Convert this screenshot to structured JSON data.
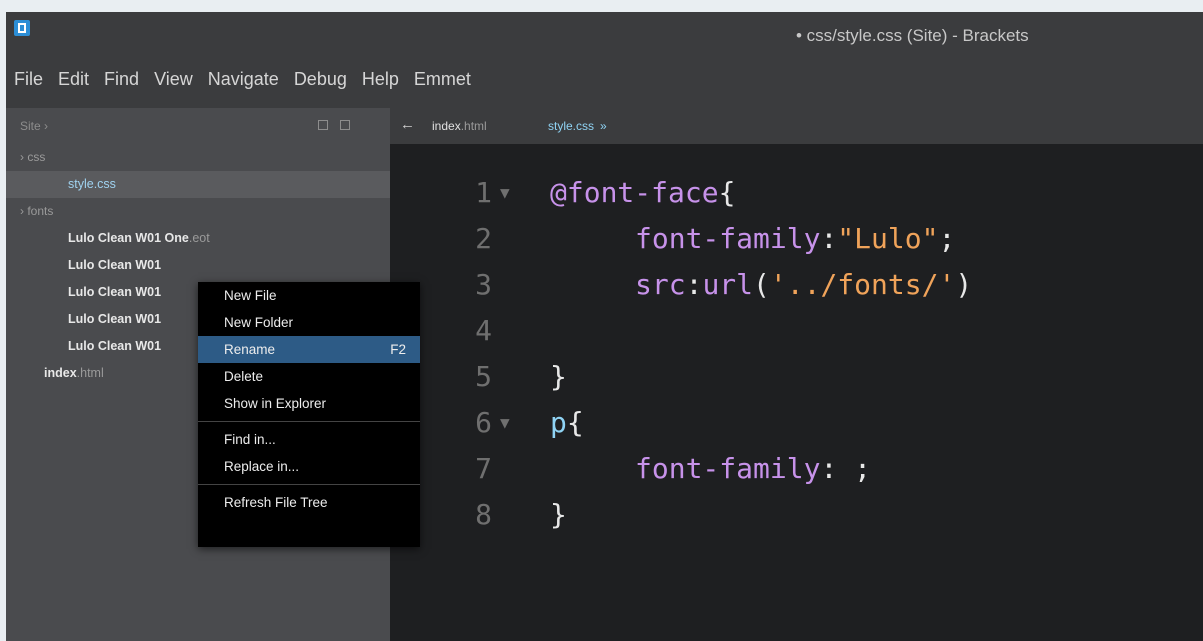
{
  "window": {
    "title": "• css/style.css (Site) - Brackets"
  },
  "menubar": [
    "File",
    "Edit",
    "Find",
    "View",
    "Navigate",
    "Debug",
    "Help",
    "Emmet"
  ],
  "sidebar": {
    "project": "Site ›",
    "tree": [
      {
        "type": "folder",
        "label": "› css"
      },
      {
        "type": "file",
        "label": "style.css",
        "selected": true
      },
      {
        "type": "folder",
        "label": "› fonts"
      },
      {
        "type": "file",
        "name": "Lulo Clean W01 One",
        "ext": ".eot"
      },
      {
        "type": "file",
        "name": "Lulo Clean W01",
        "ext": ""
      },
      {
        "type": "file",
        "name": "Lulo Clean W01",
        "ext": ""
      },
      {
        "type": "file",
        "name": "Lulo Clean W01",
        "ext": ""
      },
      {
        "type": "file",
        "name": "Lulo Clean W01",
        "ext": ""
      },
      {
        "type": "file",
        "name": "index",
        "ext": ".html"
      }
    ]
  },
  "tabs": [
    {
      "name": "index",
      "ext": ".html",
      "active": false
    },
    {
      "name": "style.css",
      "ext": "",
      "active": true,
      "dirty": "»"
    }
  ],
  "context_menu": {
    "items": [
      {
        "label": "New File"
      },
      {
        "label": "New Folder"
      },
      {
        "label": "Rename",
        "shortcut": "F2",
        "highlight": true
      },
      {
        "label": "Delete"
      },
      {
        "label": "Show in Explorer"
      },
      {
        "separator": true
      },
      {
        "label": "Find in..."
      },
      {
        "label": "Replace in..."
      },
      {
        "separator": true
      },
      {
        "label": "Refresh File Tree"
      }
    ]
  },
  "code": {
    "line_numbers": [
      "1",
      "2",
      "3",
      "4",
      "5",
      "6",
      "7",
      "8"
    ],
    "fold_marker": "▼",
    "lines": [
      {
        "tokens": [
          [
            "at",
            "@font-face"
          ],
          [
            "punc",
            "{"
          ]
        ],
        "indent": 0,
        "fold": true
      },
      {
        "tokens": [
          [
            "prop",
            "font-family"
          ],
          [
            "punc",
            ":"
          ],
          [
            "str",
            "\"Lulo\""
          ],
          [
            "punc",
            ";"
          ]
        ],
        "indent": 1
      },
      {
        "tokens": [
          [
            "prop",
            "src"
          ],
          [
            "punc",
            ":"
          ],
          [
            "func",
            "url"
          ],
          [
            "punc",
            "("
          ],
          [
            "str",
            "'../fonts/'"
          ],
          [
            "punc",
            ")"
          ]
        ],
        "indent": 1
      },
      {
        "tokens": [],
        "indent": 0
      },
      {
        "tokens": [
          [
            "punc",
            "}"
          ]
        ],
        "indent": 0
      },
      {
        "tokens": [
          [
            "sel",
            "p"
          ],
          [
            "punc",
            "{"
          ]
        ],
        "indent": 0,
        "fold": true
      },
      {
        "tokens": [
          [
            "prop",
            "font-family"
          ],
          [
            "punc",
            ": ;"
          ]
        ],
        "indent": 1
      },
      {
        "tokens": [
          [
            "punc",
            "}"
          ]
        ],
        "indent": 0
      }
    ]
  }
}
